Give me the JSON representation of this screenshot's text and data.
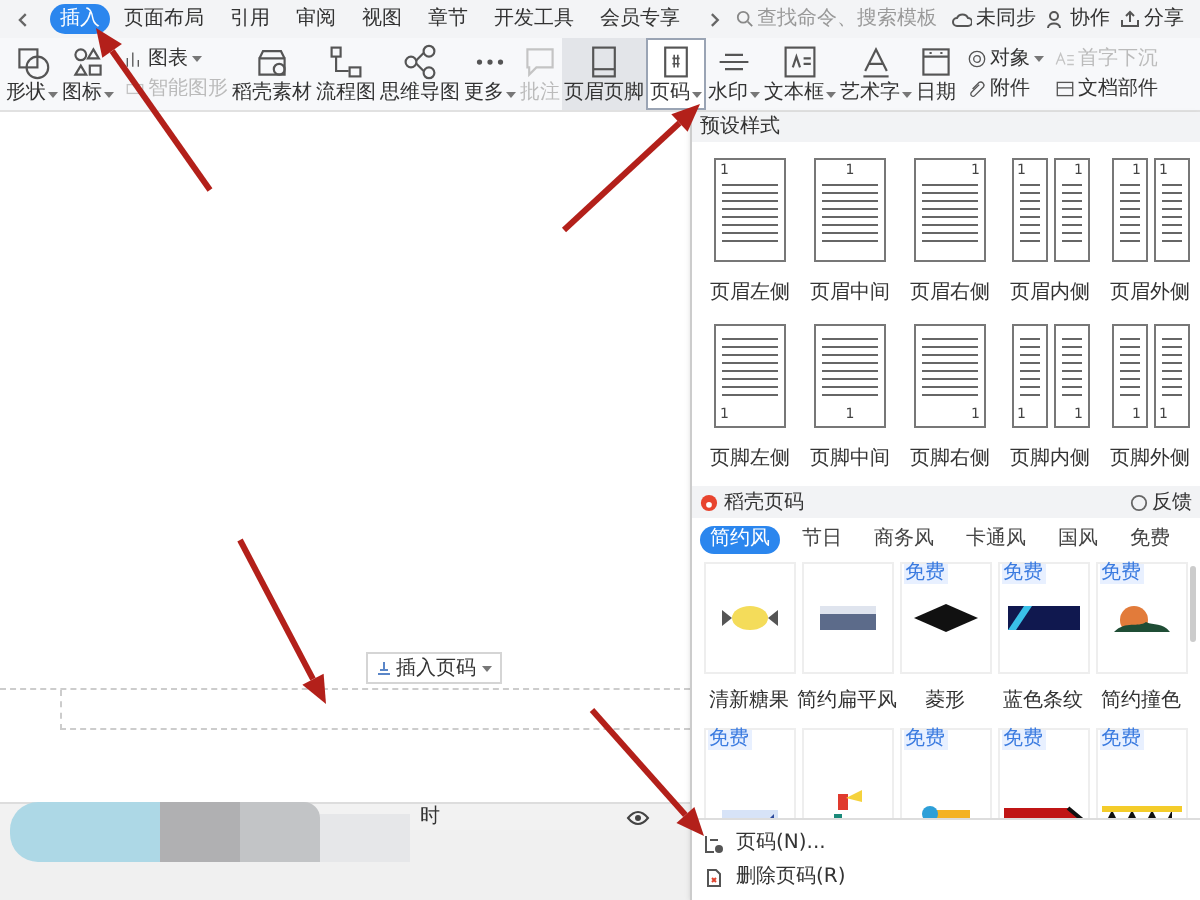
{
  "menu_tabs": [
    {
      "label": "插入",
      "selected": true
    },
    {
      "label": "页面布局",
      "selected": false
    },
    {
      "label": "引用",
      "selected": false
    },
    {
      "label": "审阅",
      "selected": false
    },
    {
      "label": "视图",
      "selected": false
    },
    {
      "label": "章节",
      "selected": false
    },
    {
      "label": "开发工具",
      "selected": false
    },
    {
      "label": "会员专享",
      "selected": false
    }
  ],
  "search": {
    "placeholder": "查找命令、搜索模板"
  },
  "header_actions": [
    {
      "kind": "cloud",
      "label": "未同步"
    },
    {
      "kind": "people",
      "label": "协作"
    },
    {
      "kind": "share",
      "label": "分享"
    }
  ],
  "ribbon": [
    {
      "kind": "large",
      "label": "形状",
      "dropdown": true,
      "selected": false,
      "disabled": false
    },
    {
      "kind": "large",
      "label": "图标",
      "dropdown": true,
      "selected": false,
      "disabled": false
    },
    {
      "kind": "stack",
      "items": [
        {
          "label": "图表",
          "dropdown": true,
          "disabled": false
        },
        {
          "label": "智能图形",
          "dropdown": false,
          "disabled": true
        }
      ]
    },
    {
      "kind": "large",
      "label": "稻壳素材",
      "dropdown": false,
      "selected": false,
      "disabled": false
    },
    {
      "kind": "large",
      "label": "流程图",
      "dropdown": false,
      "selected": false,
      "disabled": false
    },
    {
      "kind": "large",
      "label": "思维导图",
      "dropdown": false,
      "selected": false,
      "disabled": false
    },
    {
      "kind": "large",
      "label": "更多",
      "dropdown": true,
      "selected": false,
      "disabled": false
    },
    {
      "kind": "large",
      "label": "批注",
      "dropdown": false,
      "selected": false,
      "disabled": true
    },
    {
      "kind": "large",
      "label": "页眉页脚",
      "dropdown": false,
      "selected": true,
      "disabled": false
    },
    {
      "kind": "large",
      "label": "页码",
      "dropdown": true,
      "selected": true,
      "disabled": false
    },
    {
      "kind": "large",
      "label": "水印",
      "dropdown": true,
      "selected": false,
      "disabled": false
    },
    {
      "kind": "large",
      "label": "文本框",
      "dropdown": true,
      "selected": false,
      "disabled": false
    },
    {
      "kind": "large",
      "label": "艺术字",
      "dropdown": true,
      "selected": false,
      "disabled": false
    },
    {
      "kind": "large",
      "label": "日期",
      "dropdown": false,
      "selected": false,
      "disabled": false
    },
    {
      "kind": "stack",
      "items": [
        {
          "label": "对象",
          "dropdown": true,
          "disabled": false
        },
        {
          "label": "附件",
          "dropdown": false,
          "disabled": false
        }
      ]
    },
    {
      "kind": "stack",
      "items": [
        {
          "label": "首字下沉",
          "dropdown": false,
          "disabled": true
        },
        {
          "label": "文档部件",
          "dropdown": false,
          "disabled": false
        }
      ]
    }
  ],
  "document": {
    "insert_button": {
      "label": "插入页码",
      "dropdown": true
    },
    "status_text": "时"
  },
  "page_number_panel": {
    "preset_title": "预设样式",
    "presets": [
      {
        "label": "页眉左侧",
        "page_numbers": [
          "1"
        ]
      },
      {
        "label": "页眉中间",
        "page_numbers": [
          "1"
        ]
      },
      {
        "label": "页眉右侧",
        "page_numbers": [
          "1"
        ]
      },
      {
        "label": "页眉内侧",
        "page_numbers": [
          "1",
          "1"
        ]
      },
      {
        "label": "页眉外侧",
        "page_numbers": [
          "1",
          "1"
        ]
      },
      {
        "label": "页脚左侧",
        "page_numbers": [
          "1"
        ]
      },
      {
        "label": "页脚中间",
        "page_numbers": [
          "1"
        ]
      },
      {
        "label": "页脚右侧",
        "page_numbers": [
          "1"
        ]
      },
      {
        "label": "页脚内侧",
        "page_numbers": [
          "1",
          "1"
        ]
      },
      {
        "label": "页脚外侧",
        "page_numbers": [
          "1",
          "1"
        ]
      }
    ],
    "store_title": "稻壳页码",
    "feedback": "反馈",
    "filters": [
      {
        "label": "简约风",
        "selected": true
      },
      {
        "label": "节日",
        "selected": false
      },
      {
        "label": "商务风",
        "selected": false
      },
      {
        "label": "卡通风",
        "selected": false
      },
      {
        "label": "国风",
        "selected": false
      },
      {
        "label": "免费",
        "selected": false
      }
    ],
    "templates": [
      {
        "kind": "candy",
        "label": "清新糖果"
      },
      {
        "kind": "flat",
        "label": "简约扁平风"
      },
      {
        "kind": "diamond",
        "badge": "免费",
        "label": "菱形"
      },
      {
        "kind": "stripe",
        "badge": "免费",
        "label": "蓝色条纹"
      },
      {
        "kind": "clash",
        "badge": "免费",
        "label": "简约撞色"
      },
      {
        "kind": "corner",
        "badge": "免费"
      },
      {
        "kind": "figure"
      },
      {
        "kind": "dot",
        "badge": "免费"
      },
      {
        "kind": "arrow",
        "badge": "免费"
      },
      {
        "kind": "zigzag",
        "badge": "免费"
      }
    ],
    "menu": [
      {
        "kind": "settings",
        "label": "页码(N)..."
      },
      {
        "kind": "delete",
        "label": "删除页码(R)"
      }
    ]
  }
}
